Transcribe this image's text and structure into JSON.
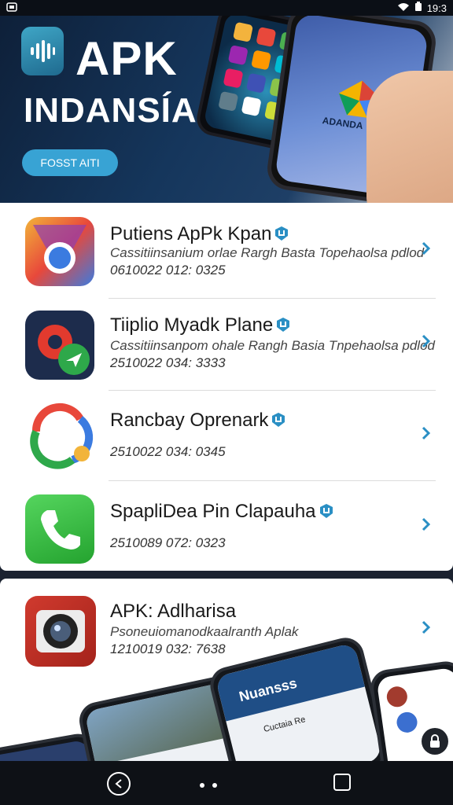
{
  "status_bar": {
    "time": "19:3"
  },
  "hero": {
    "title": "APK",
    "subtitle": "INDANSÍA",
    "cta_label": "FOSST AITI",
    "phone_screen_text": "ADANDA"
  },
  "apps": [
    {
      "name": "Putiens ApPk Kpan",
      "description": "Cassitiinsanium orlae Rargh Basta Topehaolsa pdlod",
      "meta": "0610022 012: 0325",
      "icon": "chrome-style-icon"
    },
    {
      "name": "Tiiplio Myadk Plane",
      "description": "Cassitiinsanpom ohale Rangh Basia Tnpehaolsa pdlod",
      "meta": "2510022 034: 3333",
      "icon": "gear-send-icon"
    },
    {
      "name": "Rancbay Oprenark",
      "description": "",
      "meta": "2510022 034: 0345",
      "icon": "swirl-icon"
    },
    {
      "name": "SpapliDea Pin Clapauha",
      "description": "",
      "meta": "2510089 072: 0323",
      "icon": "phone-icon"
    }
  ],
  "featured": {
    "name": "APK: Adlharisa",
    "description": "Psoneuiomanodkaalranth Aplak",
    "meta": "1210019 032: 7638",
    "icon": "camera-icon",
    "mock_screen_title": "Nuansss",
    "mock_screen_item": "Cuctaia Re"
  },
  "colors": {
    "accent": "#38a3d4",
    "verified": "#2a8fc4",
    "chevron": "#2a8fc4"
  }
}
